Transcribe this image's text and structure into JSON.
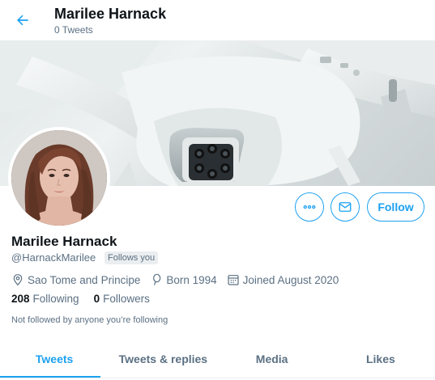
{
  "header": {
    "title": "Marilee Harnack",
    "subtitle": "0 Tweets"
  },
  "profile": {
    "name": "Marilee Harnack",
    "handle": "@HarnackMarilee",
    "follows_you": "Follows you",
    "location": "Sao Tome and Principe",
    "born": "Born 1994",
    "joined": "Joined August 2020",
    "following_count": "208",
    "following_label": "Following",
    "followers_count": "0",
    "followers_label": "Followers",
    "not_followed": "Not followed by anyone you’re following"
  },
  "actions": {
    "follow_label": "Follow"
  },
  "tabs": [
    {
      "label": "Tweets",
      "active": true
    },
    {
      "label": "Tweets & replies",
      "active": false
    },
    {
      "label": "Media",
      "active": false
    },
    {
      "label": "Likes",
      "active": false
    }
  ],
  "colors": {
    "accent": "#1da1f2",
    "text_primary": "#0f1419",
    "text_secondary": "#5b7083"
  }
}
